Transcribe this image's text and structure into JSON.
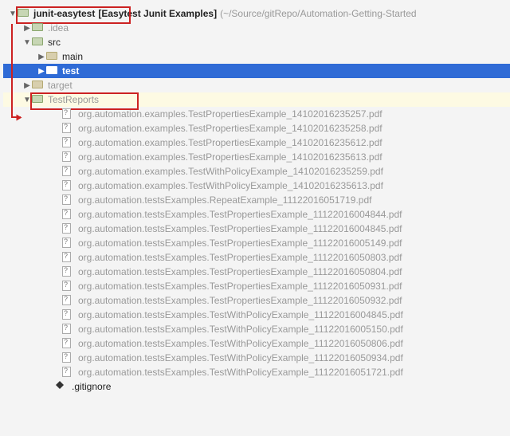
{
  "root": {
    "name": "junit-easytest",
    "desc": "[Easytest Junit Examples]",
    "path": "(~/Source/gitRepo/Automation-Getting-Started"
  },
  "folders": {
    "idea": ".idea",
    "src": "src",
    "main": "main",
    "test": "test",
    "target": "target",
    "testReports": "TestReports"
  },
  "reports": [
    "org.automation.examples.TestPropertiesExample_14102016235257.pdf",
    "org.automation.examples.TestPropertiesExample_14102016235258.pdf",
    "org.automation.examples.TestPropertiesExample_14102016235612.pdf",
    "org.automation.examples.TestPropertiesExample_14102016235613.pdf",
    "org.automation.examples.TestWithPolicyExample_14102016235259.pdf",
    "org.automation.examples.TestWithPolicyExample_14102016235613.pdf",
    "org.automation.testsExamples.RepeatExample_11122016051719.pdf",
    "org.automation.testsExamples.TestPropertiesExample_11122016004844.pdf",
    "org.automation.testsExamples.TestPropertiesExample_11122016004845.pdf",
    "org.automation.testsExamples.TestPropertiesExample_11122016005149.pdf",
    "org.automation.testsExamples.TestPropertiesExample_11122016050803.pdf",
    "org.automation.testsExamples.TestPropertiesExample_11122016050804.pdf",
    "org.automation.testsExamples.TestPropertiesExample_11122016050931.pdf",
    "org.automation.testsExamples.TestPropertiesExample_11122016050932.pdf",
    "org.automation.testsExamples.TestWithPolicyExample_11122016004845.pdf",
    "org.automation.testsExamples.TestWithPolicyExample_11122016005150.pdf",
    "org.automation.testsExamples.TestWithPolicyExample_11122016050806.pdf",
    "org.automation.testsExamples.TestWithPolicyExample_11122016050934.pdf",
    "org.automation.testsExamples.TestWithPolicyExample_11122016051721.pdf"
  ],
  "gitignore": ".gitignore"
}
